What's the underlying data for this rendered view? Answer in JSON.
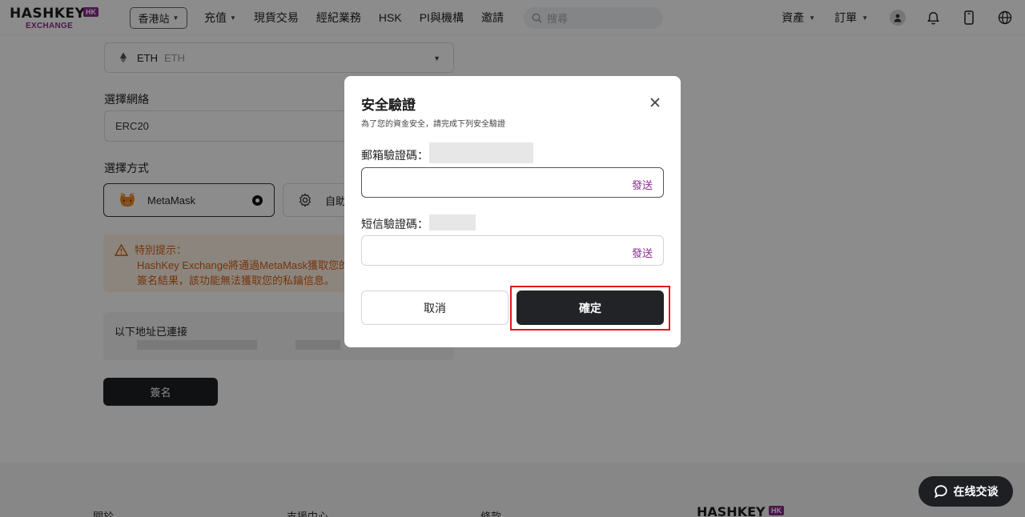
{
  "header": {
    "logo_main": "HASHKEY",
    "logo_badge": "HK",
    "logo_sub": "EXCHANGE",
    "region": "香港站",
    "nav": [
      "充值",
      "現貨交易",
      "經紀業務",
      "HSK",
      "PI與機構",
      "邀請"
    ],
    "search_placeholder": "搜尋",
    "assets": "資產",
    "orders": "訂單"
  },
  "form": {
    "coin_symbol": "ETH",
    "coin_name": "ETH",
    "network_label": "選擇網絡",
    "network_value": "ERC20",
    "method_label": "選擇方式",
    "method_metamask": "MetaMask",
    "method_other": "自助",
    "notice_title": "特別提示：",
    "notice_line1": "HashKey Exchange將通過MetaMask獲取您的僅",
    "notice_line2": "簽名結果，該功能無法獲取您的私鑰信息。",
    "address_label": "以下地址已連接",
    "sign_button": "簽名"
  },
  "footer": {
    "links": [
      "關於",
      "支援中心",
      "條款"
    ],
    "logo": "HASHKEY",
    "logo_badge": "HK"
  },
  "modal": {
    "title": "安全驗證",
    "subtitle": "為了您的資金安全，請完成下列安全驗證",
    "email_label": "郵箱驗證碼：",
    "sms_label": "短信驗證碼：",
    "send": "發送",
    "cancel": "取消",
    "confirm": "確定"
  },
  "chat": {
    "label": "在线交谈"
  },
  "colors": {
    "brand": "#8a2b8f",
    "primary_button": "#222326",
    "notice_text": "#d45f11",
    "highlight": "#e0191f"
  }
}
